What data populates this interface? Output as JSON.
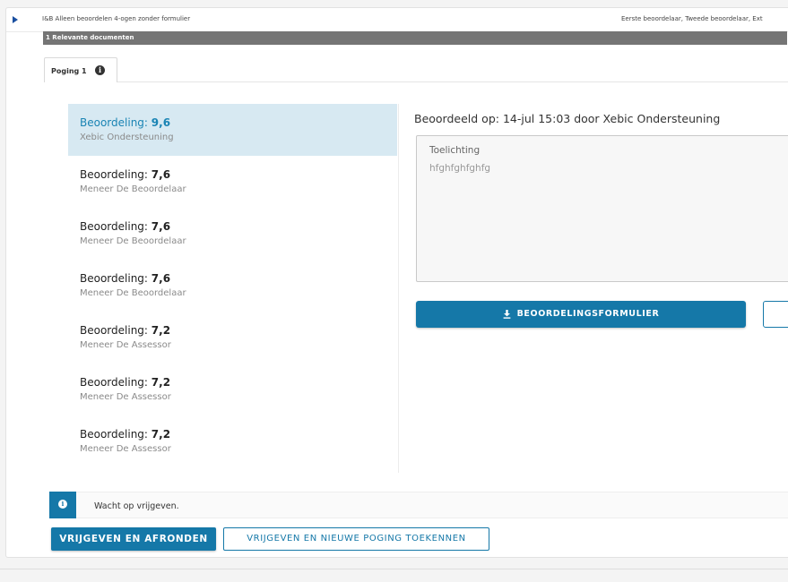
{
  "row": {
    "title": "I&B Alleen beoordelen 4-ogen zonder formulier",
    "roles": "Eerste beoordelaar, Tweede beoordelaar, Ext"
  },
  "section": {
    "title": "1 Relevante documenten"
  },
  "tabs": [
    {
      "label": "Poging 1",
      "icon": "info-icon"
    }
  ],
  "grades": [
    {
      "label": "Beoordeling: ",
      "value": "9,6",
      "assessor": "Xebic Ondersteuning",
      "selected": true
    },
    {
      "label": "Beoordeling: ",
      "value": "7,6",
      "assessor": "Meneer De Beoordelaar",
      "selected": false
    },
    {
      "label": "Beoordeling: ",
      "value": "7,6",
      "assessor": "Meneer De Beoordelaar",
      "selected": false
    },
    {
      "label": "Beoordeling: ",
      "value": "7,6",
      "assessor": "Meneer De Beoordelaar",
      "selected": false
    },
    {
      "label": "Beoordeling: ",
      "value": "7,2",
      "assessor": "Meneer De Assessor",
      "selected": false
    },
    {
      "label": "Beoordeling: ",
      "value": "7,2",
      "assessor": "Meneer De Assessor",
      "selected": false
    },
    {
      "label": "Beoordeling: ",
      "value": "7,2",
      "assessor": "Meneer De Assessor",
      "selected": false
    }
  ],
  "detail": {
    "judged_text": "Beoordeeld op: 14-jul 15:03 door Xebic Ondersteuning",
    "toelichting_label": "Toelichting",
    "toelichting_value": "hfghfghfghfg",
    "download_label": "BEOORDELINGSFORMULIER",
    "download_icon": "download-icon"
  },
  "alert": {
    "text": "Wacht op vrijgeven.",
    "icon": "info-icon"
  },
  "actions": {
    "primary": "VRIJGEVEN EN AFRONDEN",
    "secondary": "VRIJGEVEN EN NIEUWE POGING TOEKENNEN"
  },
  "colors": {
    "accent": "#1578a8",
    "selected_bg": "#d7e9f2",
    "section_bar": "#757575"
  }
}
